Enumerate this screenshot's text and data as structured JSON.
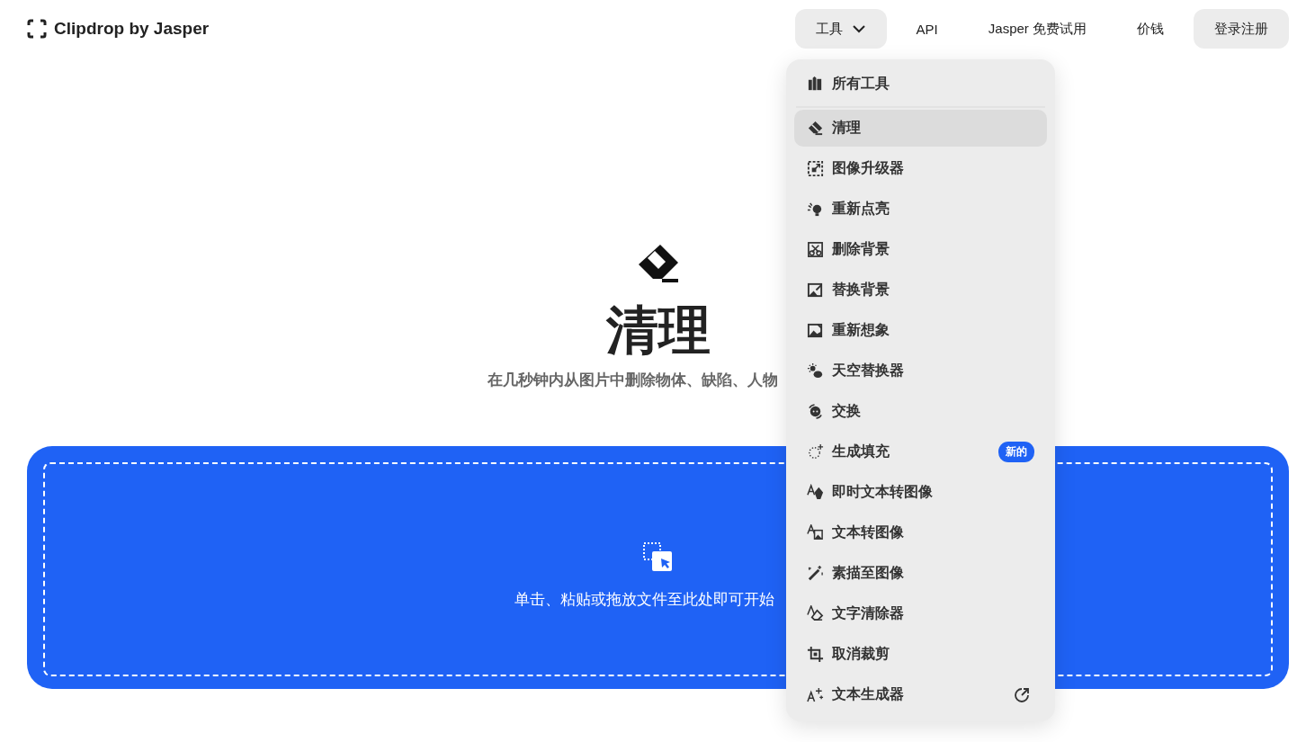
{
  "header": {
    "logo": "Clipdrop by Jasper",
    "nav": [
      {
        "label": "工具",
        "kind": "dropdown",
        "expanded": true
      },
      {
        "label": "API",
        "kind": "link"
      },
      {
        "label": "Jasper 免费试用",
        "kind": "link"
      },
      {
        "label": "价钱",
        "kind": "link"
      },
      {
        "label": "登录注册",
        "kind": "button"
      }
    ]
  },
  "hero": {
    "title": "清理",
    "subtitle": "在几秒钟内从图片中删除物体、缺陷、人物"
  },
  "dropzone": {
    "text": "单击、粘贴或拖放文件至此处即可开始"
  },
  "menu": {
    "items": [
      {
        "label": "所有工具",
        "kind": "all",
        "selected": false
      },
      {
        "label": "清理",
        "kind": "tool",
        "selected": true
      },
      {
        "label": "图像升级器",
        "kind": "tool",
        "selected": false
      },
      {
        "label": "重新点亮",
        "kind": "tool",
        "selected": false
      },
      {
        "label": "删除背景",
        "kind": "tool",
        "selected": false
      },
      {
        "label": "替换背景",
        "kind": "tool",
        "selected": false
      },
      {
        "label": "重新想象",
        "kind": "tool",
        "selected": false
      },
      {
        "label": "天空替换器",
        "kind": "tool",
        "selected": false
      },
      {
        "label": "交换",
        "kind": "tool",
        "selected": false
      },
      {
        "label": "生成填充",
        "kind": "tool",
        "selected": false,
        "badge": "新的"
      },
      {
        "label": "即时文本转图像",
        "kind": "tool",
        "selected": false
      },
      {
        "label": "文本转图像",
        "kind": "tool",
        "selected": false
      },
      {
        "label": "素描至图像",
        "kind": "tool",
        "selected": false
      },
      {
        "label": "文字清除器",
        "kind": "tool",
        "selected": false
      },
      {
        "label": "取消裁剪",
        "kind": "tool",
        "selected": false
      },
      {
        "label": "文本生成器",
        "kind": "tool",
        "selected": false,
        "external": true
      }
    ]
  }
}
